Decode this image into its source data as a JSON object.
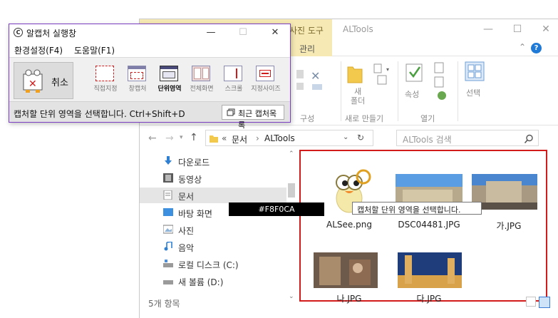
{
  "explorer": {
    "picture_tools_label": "사진 도구",
    "title": "ALTools",
    "window_controls": {
      "minimize": "—",
      "maximize": "☐",
      "close": "✕"
    },
    "manage_tab": "관리",
    "help": "?",
    "ribbon": {
      "organize_label": "구성",
      "new_folder_label": "새\n폴더",
      "new_group_label": "새로 만들기",
      "properties_label": "속성",
      "open_group_label": "열기",
      "select_label": "선택"
    },
    "address": {
      "path_prefix": "«",
      "path_parent": "문서",
      "path_sep": "›",
      "path_current": "ALTools"
    },
    "search_placeholder": "ALTools 검색",
    "nav": [
      {
        "label": "다운로드",
        "icon": "download-icon"
      },
      {
        "label": "동영상",
        "icon": "video-icon"
      },
      {
        "label": "문서",
        "icon": "document-icon"
      },
      {
        "label": "바탕 화면",
        "icon": "desktop-icon"
      },
      {
        "label": "사진",
        "icon": "picture-icon"
      },
      {
        "label": "음악",
        "icon": "music-icon"
      },
      {
        "label": "로컬 디스크 (C:)",
        "icon": "drive-icon"
      },
      {
        "label": "새 볼륨 (D:)",
        "icon": "drive-icon"
      }
    ],
    "files": [
      {
        "name": "ALSee.png"
      },
      {
        "name": "DSC04481.JPG"
      },
      {
        "name": "가.JPG"
      },
      {
        "name": "나.JPG"
      },
      {
        "name": "다.JPG"
      }
    ],
    "status": "5개 항목"
  },
  "capture_app": {
    "title": "알캡처 실행창",
    "menu": [
      "환경설정(F4)",
      "도움말(F1)"
    ],
    "cancel_label": "취소",
    "tools": [
      "직접지정",
      "창캡처",
      "단위영역",
      "전체화면",
      "스크롤",
      "지정사이즈"
    ],
    "active_tool": "단위영역",
    "status_text": "캡처할 단위 영역을 선택합니다. Ctrl+Shift+D",
    "recent_button": "최근 캡처목록",
    "window_controls": {
      "minimize": "—",
      "maximize": "☐",
      "close": "✕"
    }
  },
  "color_tooltip": "#F8F0CA",
  "capture_tooltip": "캡처할 단위 영역을 선택합니다.",
  "colors": {
    "highlight": "#d21c1c",
    "app_border": "#7c3fc4",
    "picture_tools": "#f6e9b4"
  }
}
